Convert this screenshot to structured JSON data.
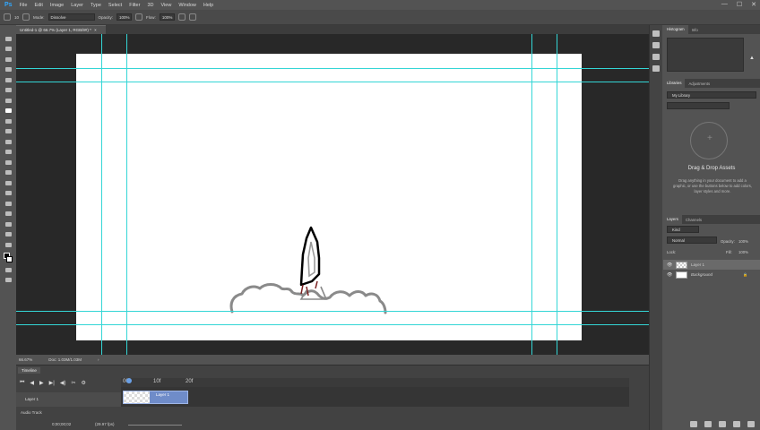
{
  "app": {
    "logo": "Ps",
    "colors": {
      "accent": "#31a8ff",
      "guide": "#34d6d6",
      "clip": "#6f8cc9"
    }
  },
  "menu": [
    "File",
    "Edit",
    "Image",
    "Layer",
    "Type",
    "Select",
    "Filter",
    "3D",
    "View",
    "Window",
    "Help"
  ],
  "window_controls": {
    "minimize": "—",
    "maximize": "☐",
    "close": "✕"
  },
  "options": {
    "brush_size": "10",
    "mode_label": "Mode:",
    "mode_value": "Dissolve",
    "opacity_label": "Opacity:",
    "opacity_value": "100%",
    "flow_label": "Flow:",
    "flow_value": "100%"
  },
  "document": {
    "tab_title": "Untitled-1 @ 66.7% (Layer 1, RGB/8#) *",
    "tab_close": "×"
  },
  "status": {
    "zoom": "66.67%",
    "doc_size": "Doc: 1.03M/1.03M",
    "arrow": "›"
  },
  "timeline": {
    "tab": "Timeline",
    "controls": [
      "⏮",
      "◀",
      "▶",
      "▶|",
      "◀)",
      "✂",
      "⚙"
    ],
    "ruler_marks": [
      "00",
      "10f",
      "20f"
    ],
    "layer_name": "Layer 1",
    "clip_label": "Layer 1",
    "audio_label": "Audio Track",
    "timecode": "0;00;00;02",
    "fps": "(29.97 fps)"
  },
  "panels": {
    "histogram_tabs": [
      "Histogram",
      "Info"
    ],
    "libraries_tabs": [
      "Libraries",
      "Adjustments"
    ],
    "library_select": "My Library",
    "library_title": "Drag & Drop Assets",
    "library_desc": "Drag anything in your document to add a graphic, or use the buttons below to add colors, layer styles and more.",
    "layers_tabs": [
      "Layers",
      "Channels"
    ],
    "filter_kind": "Kind",
    "blend_mode": "Normal",
    "opacity_label": "Opacity:",
    "opacity_value": "100%",
    "lock_label": "Lock:",
    "fill_label": "Fill:",
    "fill_value": "100%",
    "layers": [
      {
        "name": "Layer 1",
        "selected": true
      },
      {
        "name": "Background",
        "selected": false
      }
    ],
    "lock_icon": "🔒"
  }
}
